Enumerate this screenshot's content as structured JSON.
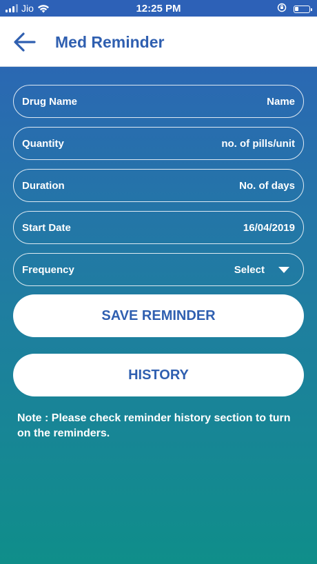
{
  "status_bar": {
    "carrier": "Jio",
    "time": "12:25 PM",
    "icons": [
      "signal-icon",
      "wifi-icon",
      "orientation-lock-icon",
      "battery-icon"
    ]
  },
  "header": {
    "back_icon": "arrow-left-icon",
    "title": "Med Reminder",
    "title_color": "#2f5fb0"
  },
  "form": {
    "drug_name": {
      "label": "Drug Name",
      "value": "Name"
    },
    "quantity": {
      "label": "Quantity",
      "value": "no. of pills/unit"
    },
    "duration": {
      "label": "Duration",
      "value": "No. of days"
    },
    "start_date": {
      "label": "Start Date",
      "value": "16/04/2019"
    },
    "frequency": {
      "label": "Frequency",
      "value": "Select",
      "icon": "triangle-down-icon"
    }
  },
  "buttons": {
    "save": "SAVE REMINDER",
    "history": "HISTORY"
  },
  "note": "Note : Please check reminder history  section to turn on the reminders.",
  "colors": {
    "gradient_top": "#2e62b8",
    "gradient_bottom": "#0f8e8a",
    "accent": "#2f5fb0",
    "button_bg": "#ffffff"
  }
}
